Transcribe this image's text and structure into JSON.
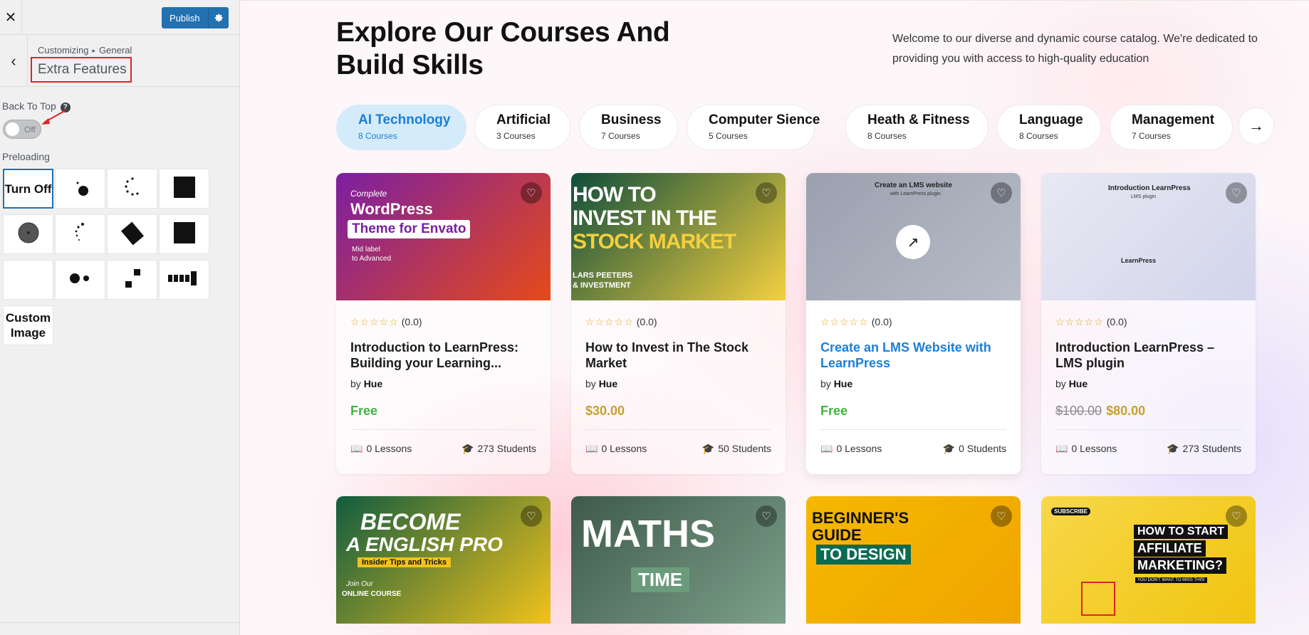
{
  "customizer": {
    "close_glyph": "✕",
    "publish_label": "Publish",
    "back_glyph": "‹",
    "breadcrumb": {
      "root": "Customizing",
      "sep": "▸",
      "section": "General"
    },
    "section_title": "Extra Features",
    "back_to_top": {
      "label": "Back To Top",
      "help": "?",
      "state": "Off"
    },
    "preloading_label": "Preloading",
    "preloader_options": [
      {
        "label": "Turn Off",
        "selected": true
      },
      {
        "label": "",
        "icon": "dot-bounce-icon"
      },
      {
        "label": "",
        "icon": "spinner-dots-icon"
      },
      {
        "label": "",
        "icon": "square-icon"
      },
      {
        "label": "",
        "icon": "circle-icon"
      },
      {
        "label": "",
        "icon": "arc-dots-icon"
      },
      {
        "label": "",
        "icon": "rotated-square-icon"
      },
      {
        "label": "",
        "icon": "square-icon"
      },
      {
        "label": "",
        "icon": "blank-icon"
      },
      {
        "label": "",
        "icon": "two-dots-icon"
      },
      {
        "label": "",
        "icon": "two-squares-icon"
      },
      {
        "label": "",
        "icon": "bars-icon"
      },
      {
        "label": "Custom Image"
      }
    ]
  },
  "preview": {
    "heading": "Explore Our Courses And Build Skills",
    "intro": "Welcome to our diverse and dynamic course catalog. We're dedicated to providing you with access to high-quality education",
    "categories": [
      {
        "name": "AI Technology",
        "count": "8 Courses",
        "active": true
      },
      {
        "name": "Artificial",
        "count": "3 Courses"
      },
      {
        "name": "Business",
        "count": "7 Courses"
      },
      {
        "name": "Computer Sience",
        "count": "5 Courses"
      },
      {
        "name": "Heath & Fitness",
        "count": "8 Courses"
      },
      {
        "name": "Language",
        "count": "8 Courses"
      },
      {
        "name": "Management",
        "count": "7 Courses"
      }
    ],
    "next_arrow": "→",
    "courses": [
      {
        "thumb_lines": [
          "Complete",
          "WordPress",
          "Theme for Envato",
          "Mid label",
          "to Advanced"
        ],
        "rating": "(0.0)",
        "title": "Introduction to LearnPress: Building your Learning...",
        "by": "by",
        "author": "Hue",
        "price": "Free",
        "old_price": "",
        "lessons": "0 Lessons",
        "students": "273 Students",
        "colors": [
          "#7b1fa2",
          "#e64a19"
        ]
      },
      {
        "thumb_lines": [
          "HOW TO",
          "INVEST IN THE",
          "STOCK MARKET",
          "LARS PEETERS",
          "& INVESTMENT"
        ],
        "rating": "(0.0)",
        "title": "How to Invest in The Stock Market",
        "by": "by",
        "author": "Hue",
        "price": "$30.00",
        "old_price": "",
        "lessons": "0 Lessons",
        "students": "50 Students",
        "colors": [
          "#0f4d3c",
          "#f4d03f"
        ]
      },
      {
        "thumb_lines": [
          "Create an LMS website",
          "with LearnPress plugin"
        ],
        "rating": "(0.0)",
        "title": "Create an LMS Website with LearnPress",
        "by": "by",
        "author": "Hue",
        "price": "Free",
        "old_price": "",
        "lessons": "0 Lessons",
        "students": "0 Students",
        "colors": [
          "#9aa0ae",
          "#b7bcc8"
        ]
      },
      {
        "thumb_lines": [
          "Introduction LearnPress",
          "LMS plugin",
          "LearnPress"
        ],
        "rating": "(0.0)",
        "title": "Introduction LearnPress – LMS plugin",
        "by": "by",
        "author": "Hue",
        "price": "$80.00",
        "old_price": "$100.00",
        "lessons": "0 Lessons",
        "students": "273 Students",
        "colors": [
          "#e8e9f4",
          "#d2d5ea"
        ]
      }
    ],
    "courses_row2": [
      {
        "thumb_lines": [
          "BECOME",
          "A ENGLISH PRO",
          "Insider Tips and Tricks",
          "Join Our",
          "ONLINE COURSE"
        ],
        "colors": [
          "#115c3f",
          "#f2c21b"
        ]
      },
      {
        "thumb_lines": [
          "MATHS",
          "TIME"
        ],
        "colors": [
          "#3e5a4a",
          "#7ea18b"
        ]
      },
      {
        "thumb_lines": [
          "BEGINNER'S",
          "GUIDE",
          "TO DESIGN"
        ],
        "colors": [
          "#f5b800",
          "#f0a500"
        ]
      },
      {
        "thumb_lines": [
          "SUBSCRIBE",
          "HOW TO START",
          "AFFILIATE",
          "MARKETING?",
          "YOU DON'T WANT TO MISS THIS!"
        ],
        "colors": [
          "#f7d84a",
          "#f1c40f"
        ]
      }
    ],
    "star_glyphs": "☆☆☆☆☆",
    "heart_glyph": "♡",
    "lessons_icon": "📖",
    "students_icon": "🎓"
  }
}
